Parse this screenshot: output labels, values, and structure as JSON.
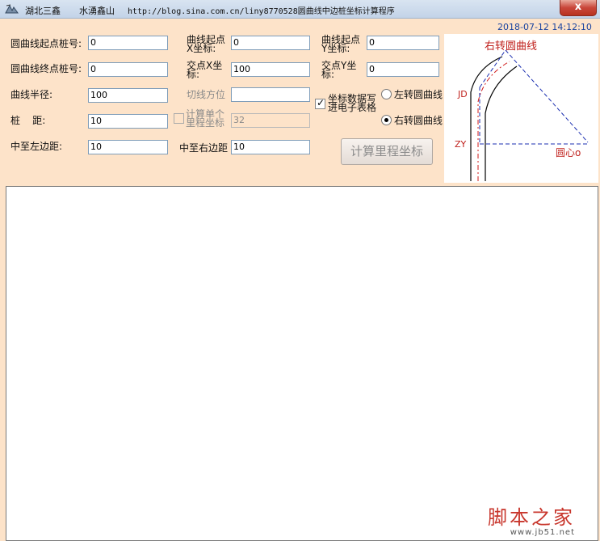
{
  "titlebar": {
    "text1": "湖北三鑫",
    "text2": "水湧鑫山",
    "text3": "http://blog.sina.com.cn/liny8770528圆曲线中边桩坐标计算程序",
    "close": "x"
  },
  "datetime": "2018-07-12  14:12:10",
  "form": {
    "start_station": {
      "label": "圆曲线起点桩号:",
      "value": "0"
    },
    "end_station": {
      "label": "圆曲线终点桩号:",
      "value": "0"
    },
    "radius": {
      "label": "曲线半径:",
      "value": "100"
    },
    "interval": {
      "label": "桩    距:",
      "value": "10"
    },
    "left_dist": {
      "label": "中至左边距:",
      "value": "10"
    },
    "start_x": {
      "label1": "曲线起点",
      "label2": "X坐标:",
      "value": "0"
    },
    "jd_x": {
      "label1": "交点X坐",
      "label2": "标:",
      "value": "100"
    },
    "tangent_dir": {
      "label": "切线方位",
      "value": ""
    },
    "single_calc": {
      "label1": "计算单个",
      "label2": "里程坐标",
      "value": "32",
      "checked": false
    },
    "right_dist": {
      "label": "中至右边距",
      "value": "10"
    },
    "start_y": {
      "label1": "曲线起点",
      "label2": "Y坐标:",
      "value": "0"
    },
    "jd_y": {
      "label1": "交点Y坐",
      "label2": "标:",
      "value": "0"
    },
    "write_excel": {
      "label1": "坐标数据写",
      "label2": "进电子表格",
      "checked": true
    },
    "left_curve": {
      "label": "左转圆曲线",
      "selected": false
    },
    "right_curve": {
      "label": "右转圆曲线",
      "selected": true
    },
    "calc_button": "计算里程坐标"
  },
  "diagram": {
    "title": "右转圆曲线",
    "jd": "JD",
    "zy": "ZY",
    "center": "圆心o"
  },
  "watermark": {
    "title": "脚本之家",
    "url": "www.jb51.net"
  }
}
